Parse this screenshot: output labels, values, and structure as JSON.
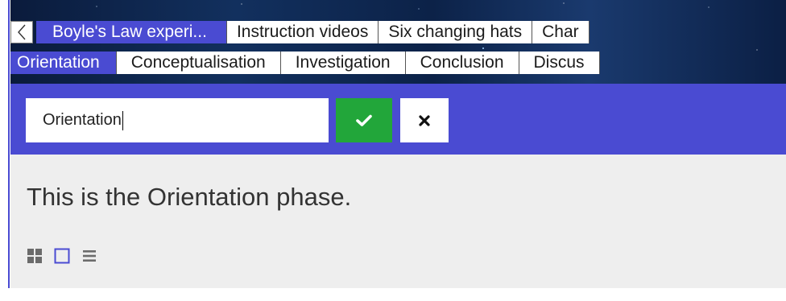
{
  "top_tabs": {
    "back_label": "<",
    "items": [
      {
        "label": "Boyle's Law experi...",
        "active": true
      },
      {
        "label": "Instruction videos",
        "active": false
      },
      {
        "label": "Six changing hats",
        "active": false
      },
      {
        "label": "Char",
        "active": false
      }
    ]
  },
  "phase_tabs": {
    "items": [
      {
        "label": "Orientation",
        "active": true
      },
      {
        "label": "Conceptualisation",
        "active": false
      },
      {
        "label": "Investigation",
        "active": false
      },
      {
        "label": "Conclusion",
        "active": false
      },
      {
        "label": "Discus",
        "active": false
      }
    ]
  },
  "edit_bar": {
    "input_value": "Orientation",
    "confirm_icon": "check-icon",
    "cancel_icon": "close-icon"
  },
  "content": {
    "text": "This is the Orientation phase.",
    "view_icons": [
      "grid-view-icon",
      "single-view-icon",
      "list-view-icon"
    ]
  },
  "colors": {
    "accent": "#4a4bd2",
    "confirm": "#22a63a",
    "content_bg": "#eeeeee"
  }
}
